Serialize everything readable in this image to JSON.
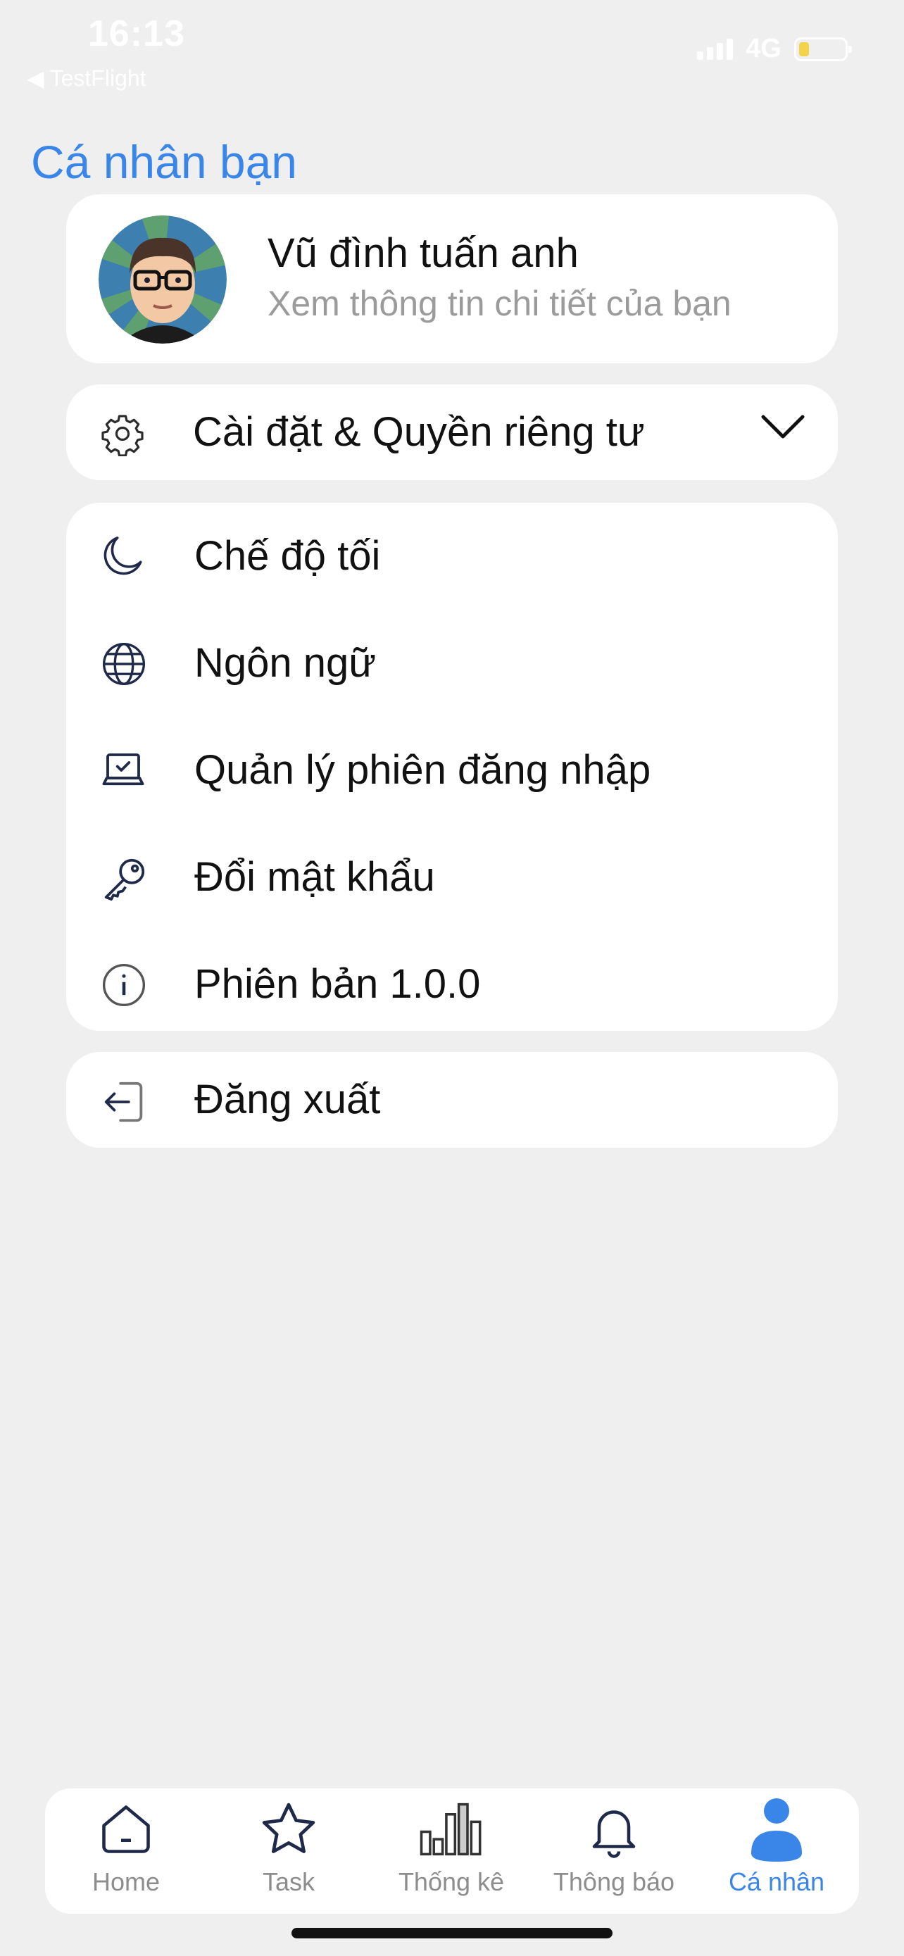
{
  "status_bar": {
    "time": "16:13",
    "back_app": "TestFlight",
    "network": "4G"
  },
  "header": {
    "title": "Cá nhân bạn"
  },
  "profile": {
    "name": "Vũ đình tuấn anh",
    "subtitle": "Xem thông tin chi tiết của bạn"
  },
  "settings": {
    "label": "Cài đặt & Quyền riêng tư",
    "expanded": true
  },
  "menu": {
    "items": [
      {
        "label": "Chế độ tối",
        "icon": "moon-icon"
      },
      {
        "label": "Ngôn ngữ",
        "icon": "globe-icon"
      },
      {
        "label": "Quản lý phiên đăng nhập",
        "icon": "laptop-check-icon"
      },
      {
        "label": "Đổi mật khẩu",
        "icon": "key-icon"
      },
      {
        "label": "Phiên bản 1.0.0",
        "icon": "info-icon"
      }
    ]
  },
  "logout": {
    "label": "Đăng xuất",
    "icon": "logout-icon"
  },
  "tabbar": {
    "tabs": [
      {
        "label": "Home",
        "icon": "home-icon",
        "active": false
      },
      {
        "label": "Task",
        "icon": "star-icon",
        "active": false
      },
      {
        "label": "Thống kê",
        "icon": "chart-icon",
        "active": false
      },
      {
        "label": "Thông báo",
        "icon": "bell-icon",
        "active": false
      },
      {
        "label": "Cá nhân",
        "icon": "person-icon",
        "active": true
      }
    ]
  },
  "colors": {
    "accent": "#3a86e8",
    "background": "#efefef",
    "muted_text": "#9b9b9b",
    "icon_dark": "#1f2a4a"
  }
}
